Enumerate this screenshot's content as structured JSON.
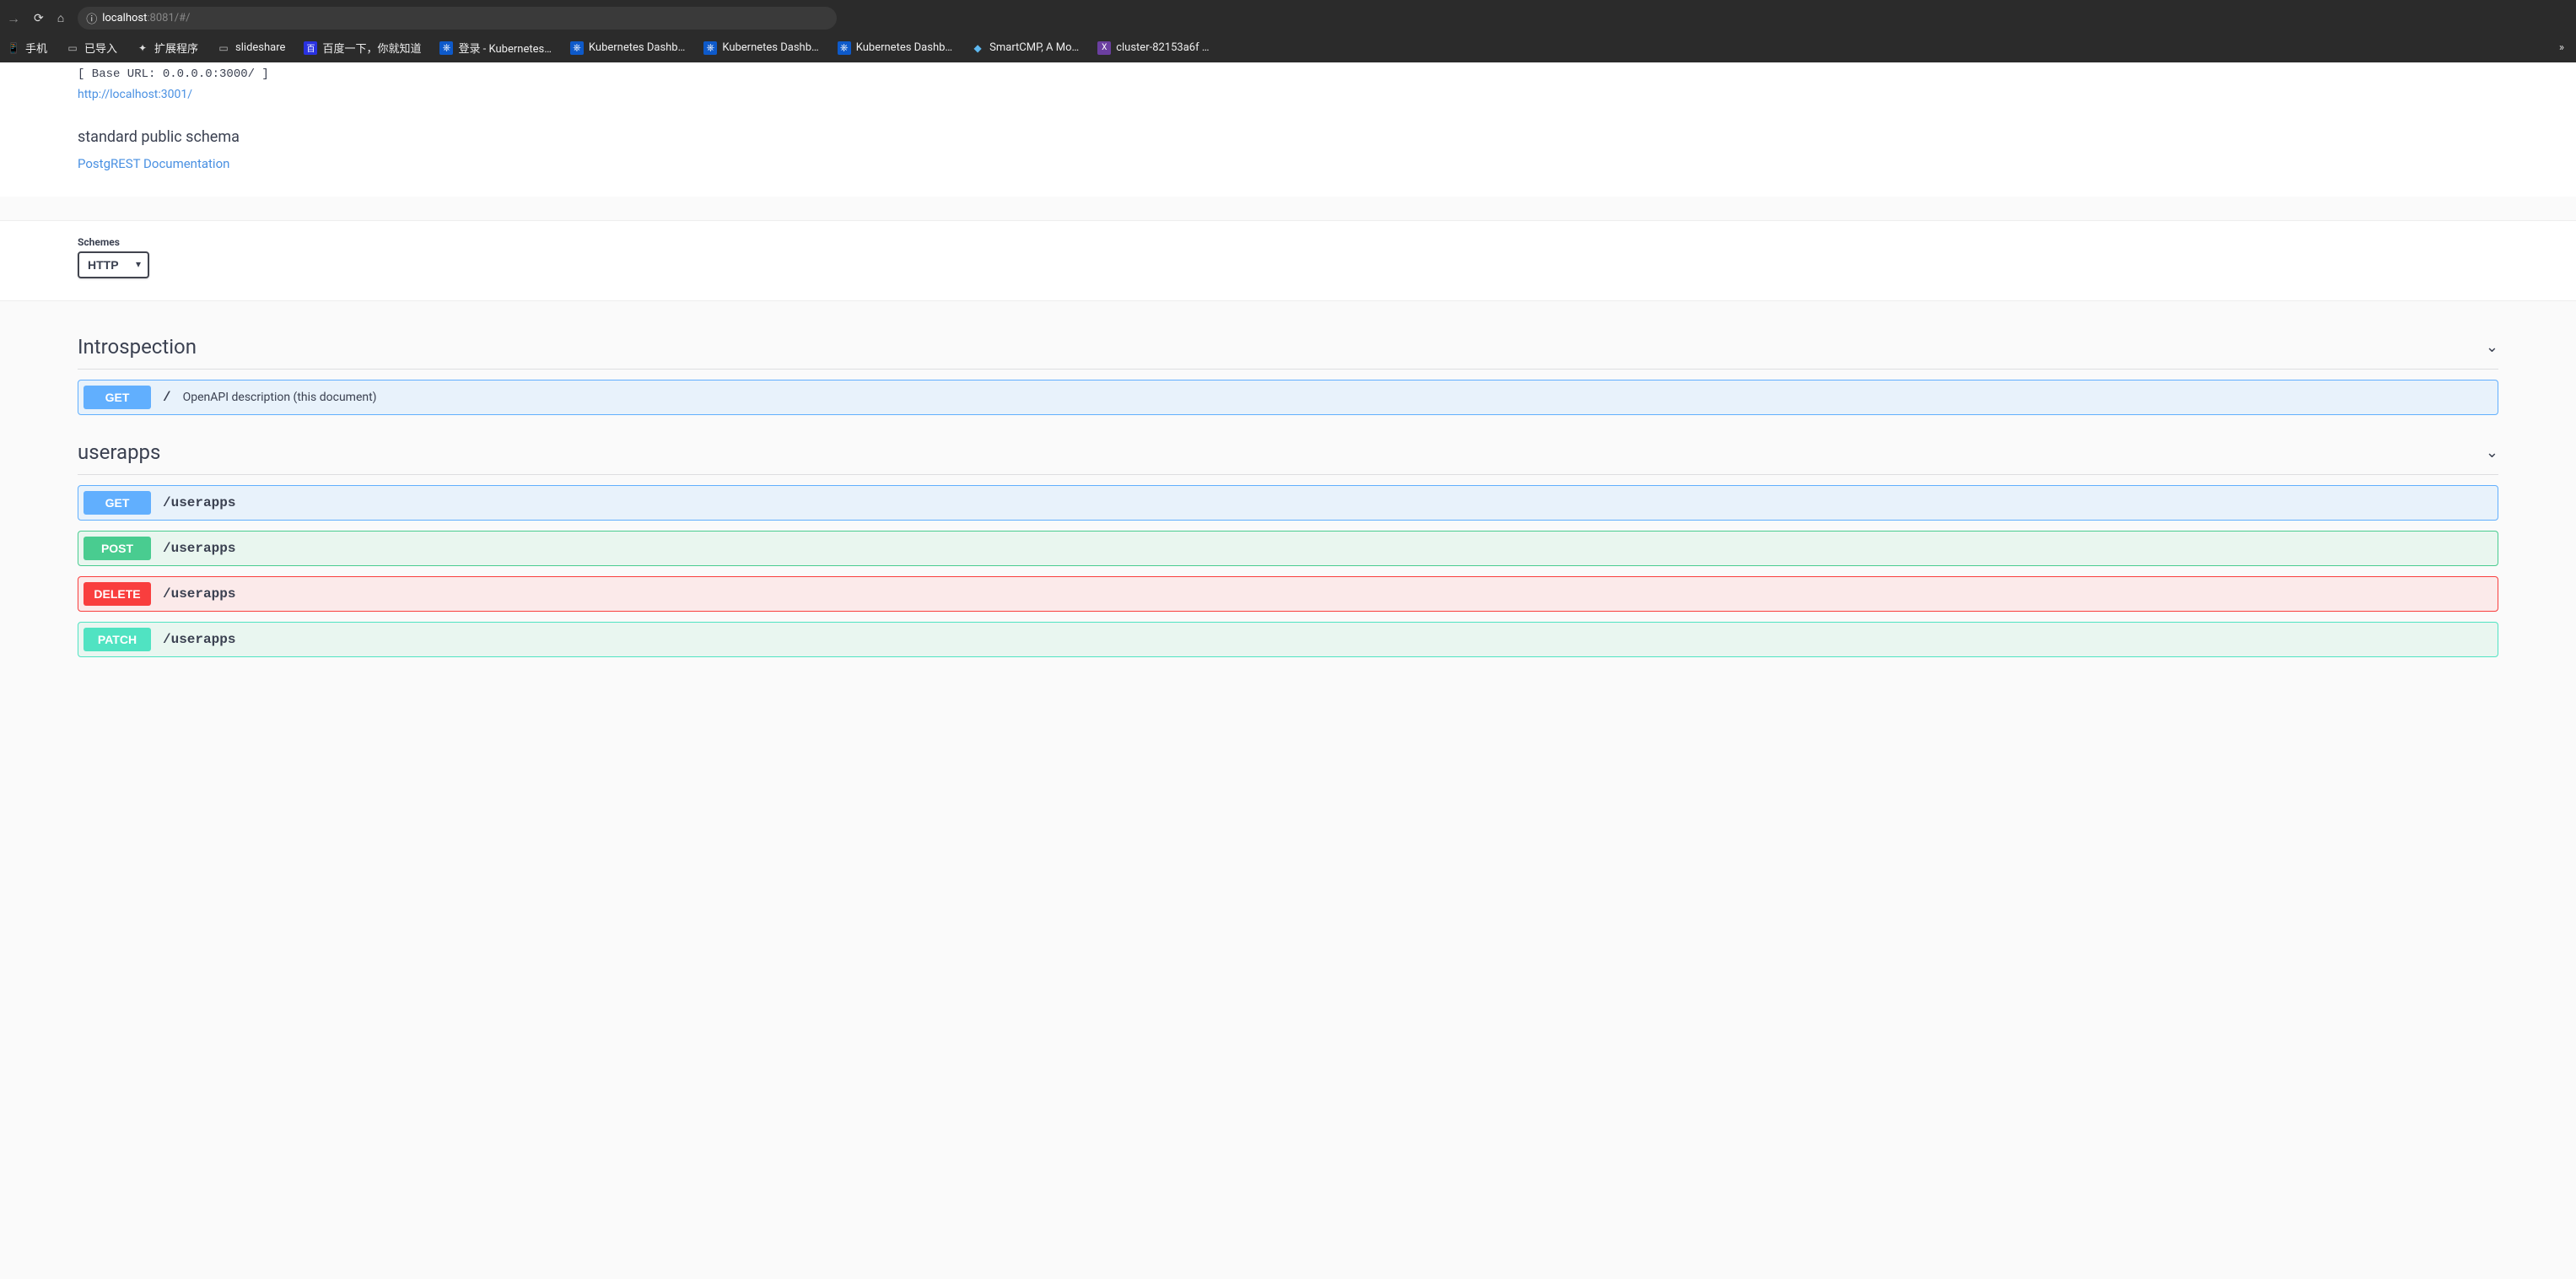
{
  "browser": {
    "url_host": "localhost",
    "url_port": ":8081/#/",
    "bookmarks": [
      {
        "icon": "phone-icon",
        "label": "手机"
      },
      {
        "icon": "folder-icon",
        "label": "已导入"
      },
      {
        "icon": "puzzle-icon",
        "label": "扩展程序"
      },
      {
        "icon": "folder-icon",
        "label": "slideshare"
      },
      {
        "icon": "baidu-icon",
        "label": "百度一下，你就知道"
      },
      {
        "icon": "k8s-icon",
        "label": "登录 - Kubernetes…"
      },
      {
        "icon": "k8s-icon",
        "label": "Kubernetes Dashb…"
      },
      {
        "icon": "k8s-icon",
        "label": "Kubernetes Dashb…"
      },
      {
        "icon": "k8s-icon",
        "label": "Kubernetes Dashb…"
      },
      {
        "icon": "smartcmp-icon",
        "label": "SmartCMP, A Mo…"
      },
      {
        "icon": "cluster-icon",
        "label": "cluster-82153a6f …"
      }
    ]
  },
  "header": {
    "base_url": "[ Base URL: 0.0.0.0:3000/ ]",
    "spec_link": "http://localhost:3001/",
    "schema_desc": "standard public schema",
    "doc_link": "PostgREST Documentation"
  },
  "schemes": {
    "label": "Schemes",
    "selected": "HTTP"
  },
  "tags": [
    {
      "name": "Introspection",
      "ops": [
        {
          "method": "GET",
          "method_class": "get",
          "path": "/",
          "summary": "OpenAPI description (this document)"
        }
      ]
    },
    {
      "name": "userapps",
      "ops": [
        {
          "method": "GET",
          "method_class": "get",
          "path": "/userapps",
          "summary": ""
        },
        {
          "method": "POST",
          "method_class": "post",
          "path": "/userapps",
          "summary": ""
        },
        {
          "method": "DELETE",
          "method_class": "delete",
          "path": "/userapps",
          "summary": ""
        },
        {
          "method": "PATCH",
          "method_class": "patch",
          "path": "/userapps",
          "summary": ""
        }
      ]
    }
  ]
}
